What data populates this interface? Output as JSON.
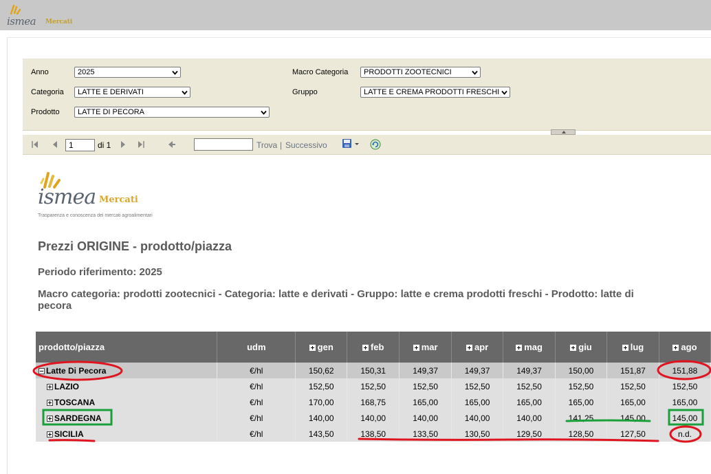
{
  "header": {
    "logo_brand": "ismea",
    "logo_sub": "Mercati"
  },
  "filters": {
    "anno_label": "Anno",
    "anno_value": "2025",
    "categoria_label": "Categoria",
    "categoria_value": "LATTE E DERIVATI",
    "prodotto_label": "Prodotto",
    "prodotto_value": "LATTE DI PECORA",
    "macro_label": "Macro Categoria",
    "macro_value": "PRODOTTI ZOOTECNICI",
    "gruppo_label": "Gruppo",
    "gruppo_value": "LATTE E CREMA PRODOTTI FRESCHI"
  },
  "toolbar": {
    "page_value": "1",
    "page_of": "di 1",
    "find_label": "Trova",
    "separator": "|",
    "next_label": "Successivo"
  },
  "report": {
    "logo_brand": "ismea",
    "logo_sub": "Mercati",
    "logo_tagline": "Trasparenza e conoscenza dei mercati agroalimentari",
    "title": "Prezzi ORIGINE - prodotto/piazza",
    "period": "Periodo riferimento: 2025",
    "macro_line": "Macro categoria: prodotti zootecnici - Categoria: latte e derivati - Gruppo: latte e crema prodotti freschi - Prodotto: latte di pecora"
  },
  "table": {
    "headers": [
      "prodotto/piazza",
      "udm",
      "gen",
      "feb",
      "mar",
      "apr",
      "mag",
      "giu",
      "lug",
      "ago"
    ],
    "rows": [
      {
        "name": "Latte Di Pecora",
        "udm": "€/hl",
        "values": [
          "150,62",
          "150,31",
          "149,37",
          "149,37",
          "149,37",
          "150,00",
          "151,87",
          "151,88"
        ]
      },
      {
        "name": "LAZIO",
        "udm": "€/hl",
        "values": [
          "152,50",
          "152,50",
          "152,50",
          "152,50",
          "152,50",
          "152,50",
          "152,50",
          "152,50"
        ]
      },
      {
        "name": "TOSCANA",
        "udm": "€/hl",
        "values": [
          "170,00",
          "168,75",
          "165,00",
          "165,00",
          "165,00",
          "165,00",
          "165,00",
          "165,00"
        ]
      },
      {
        "name": "SARDEGNA",
        "udm": "€/hl",
        "values": [
          "140,00",
          "140,00",
          "140,00",
          "140,00",
          "140,00",
          "141,25",
          "145,00",
          "145,00"
        ]
      },
      {
        "name": "SICILIA",
        "udm": "€/hl",
        "values": [
          "143,50",
          "138,50",
          "133,50",
          "130,50",
          "129,50",
          "128,50",
          "127,50",
          "n.d."
        ]
      }
    ]
  },
  "colors": {
    "header_bar": "#c8c8c8",
    "panel": "#ece9d8",
    "table_header": "#686868",
    "annot_red": "#e0141e",
    "annot_green": "#1aa03a"
  }
}
